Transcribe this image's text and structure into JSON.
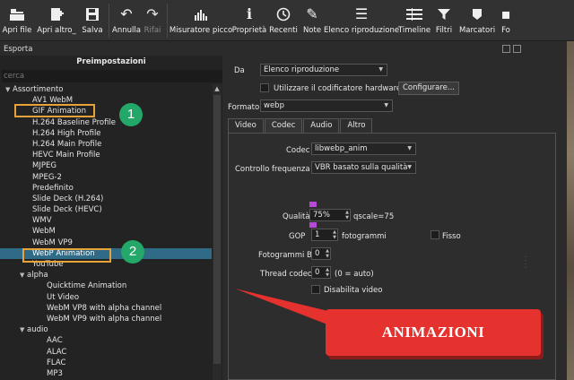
{
  "toolbar": {
    "items": [
      {
        "label": "Apri file",
        "icon": "open-file-icon"
      },
      {
        "label": "Apri altro_",
        "icon": "open-other-icon"
      },
      {
        "label": "Salva",
        "icon": "save-icon"
      },
      {
        "label": "Annulla",
        "icon": "undo-icon"
      },
      {
        "label": "Rifai",
        "icon": "redo-icon"
      },
      {
        "label": "Misuratore picco",
        "icon": "peak-meter-icon"
      },
      {
        "label": "Proprietà",
        "icon": "info-icon"
      },
      {
        "label": "Recenti",
        "icon": "clock-icon"
      },
      {
        "label": "Note",
        "icon": "notes-icon"
      },
      {
        "label": "Elenco riproduzione",
        "icon": "playlist-icon"
      },
      {
        "label": "Timeline",
        "icon": "timeline-icon"
      },
      {
        "label": "Filtri",
        "icon": "filter-icon"
      },
      {
        "label": "Marcatori",
        "icon": "marker-icon"
      },
      {
        "label": "Fo",
        "icon": "more-icon"
      }
    ]
  },
  "panel": {
    "title": "Esporta"
  },
  "presets": {
    "header": "Preimpostazioni",
    "search_placeholder": "cerca",
    "items": [
      {
        "label": "Assortimento",
        "level": "l0",
        "arrow": "▼"
      },
      {
        "label": "AV1 WebM",
        "level": "l1"
      },
      {
        "label": "GIF Animation",
        "level": "l1"
      },
      {
        "label": "H.264 Baseline Profile",
        "level": "l1"
      },
      {
        "label": "H.264 High Profile",
        "level": "l1"
      },
      {
        "label": "H.264 Main Profile",
        "level": "l1"
      },
      {
        "label": "HEVC Main Profile",
        "level": "l1"
      },
      {
        "label": "MJPEG",
        "level": "l1"
      },
      {
        "label": "MPEG-2",
        "level": "l1"
      },
      {
        "label": "Predefinito",
        "level": "l1"
      },
      {
        "label": "Slide Deck (H.264)",
        "level": "l1"
      },
      {
        "label": "Slide Deck (HEVC)",
        "level": "l1"
      },
      {
        "label": "WMV",
        "level": "l1"
      },
      {
        "label": "WebM",
        "level": "l1"
      },
      {
        "label": "WebM VP9",
        "level": "l1"
      },
      {
        "label": "WebP Animation",
        "level": "l1",
        "selected": true
      },
      {
        "label": "YouTube",
        "level": "l1"
      },
      {
        "label": "alpha",
        "level": "l1c",
        "arrow": "▼"
      },
      {
        "label": "Quicktime Animation",
        "level": "l2"
      },
      {
        "label": "Ut Video",
        "level": "l2"
      },
      {
        "label": "WebM VP8 with alpha channel",
        "level": "l2"
      },
      {
        "label": "WebM VP9 with alpha channel",
        "level": "l2"
      },
      {
        "label": "audio",
        "level": "l1c",
        "arrow": "▼"
      },
      {
        "label": "AAC",
        "level": "l2"
      },
      {
        "label": "ALAC",
        "level": "l2"
      },
      {
        "label": "FLAC",
        "level": "l2"
      },
      {
        "label": "MP3",
        "level": "l2"
      }
    ]
  },
  "annotations": {
    "badge1": "1",
    "badge2": "2",
    "callout": "ANIMAZIONI",
    "callout_color": "#e5322e"
  },
  "form": {
    "da_label": "Da",
    "da_value": "Elenco riproduzione",
    "hw_label": "Utilizzare il codificatore hardware",
    "configure_label": "Configurare...",
    "formato_label": "Formato",
    "formato_value": "webp",
    "tabs": [
      "Video",
      "Codec",
      "Audio",
      "Altro"
    ],
    "active_tab": "Codec",
    "codec_label": "Codec",
    "codec_value": "libwebp_anim",
    "rate_label": "Controllo frequenza",
    "rate_value": "VBR basato sulla qualità",
    "quality_label": "Qualità",
    "quality_value": "75%",
    "quality_note": "qscale=75",
    "gop_label": "GOP",
    "gop_value": "1",
    "gop_unit": "fotogrammi",
    "fisso_label": "Fisso",
    "bframes_label": "Fotogrammi B",
    "bframes_value": "0",
    "threads_label": "Thread codec",
    "threads_value": "0",
    "threads_note": "(0 = auto)",
    "disable_video_label": "Disabilita video"
  }
}
